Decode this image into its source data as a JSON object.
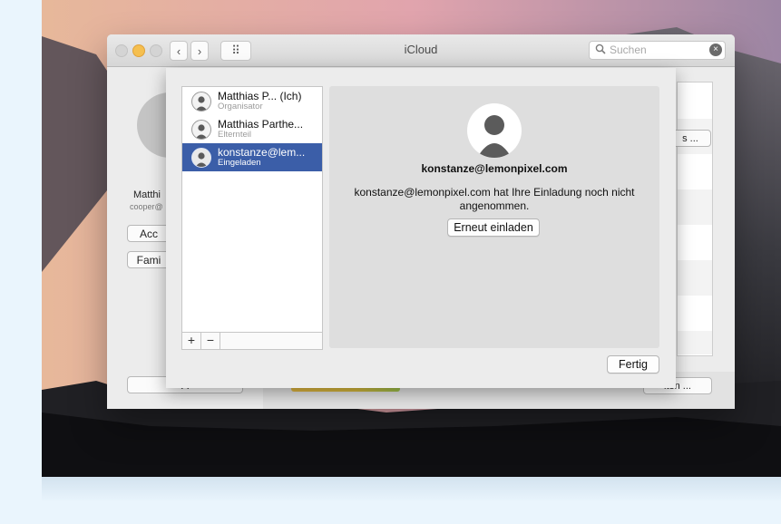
{
  "window": {
    "title": "iCloud",
    "search_placeholder": "Suchen",
    "nav_back": "‹",
    "nav_forward": "›",
    "grid_icon": "⠿"
  },
  "background_account": {
    "name_partial": "Matthi",
    "email_partial": "cooper@",
    "btn_account_partial": "Acc",
    "btn_family_partial": "Fami",
    "btn_bottom_left_partial": "A",
    "btn_right_partial": "s ...",
    "btn_bottom_right_partial": "lten ..."
  },
  "family": {
    "members": [
      {
        "name": "Matthias P...  (Ich)",
        "role": "Organisator",
        "selected": false
      },
      {
        "name": "Matthias Parthe...",
        "role": "Elternteil",
        "selected": false
      },
      {
        "name": "konstanze@lem...",
        "role": "Eingeladen",
        "selected": true
      }
    ],
    "add_label": "+",
    "remove_label": "−"
  },
  "detail": {
    "email": "konstanze@lemonpixel.com",
    "message": "konstanze@lemonpixel.com hat Ihre Einladung noch nicht angenommen.",
    "reinvite_label": "Erneut einladen"
  },
  "done_label": "Fertig",
  "colors": {
    "selection": "#3b5ea8",
    "close_light": "#d4d4d4",
    "minimize_light": "#f5bf4f"
  }
}
